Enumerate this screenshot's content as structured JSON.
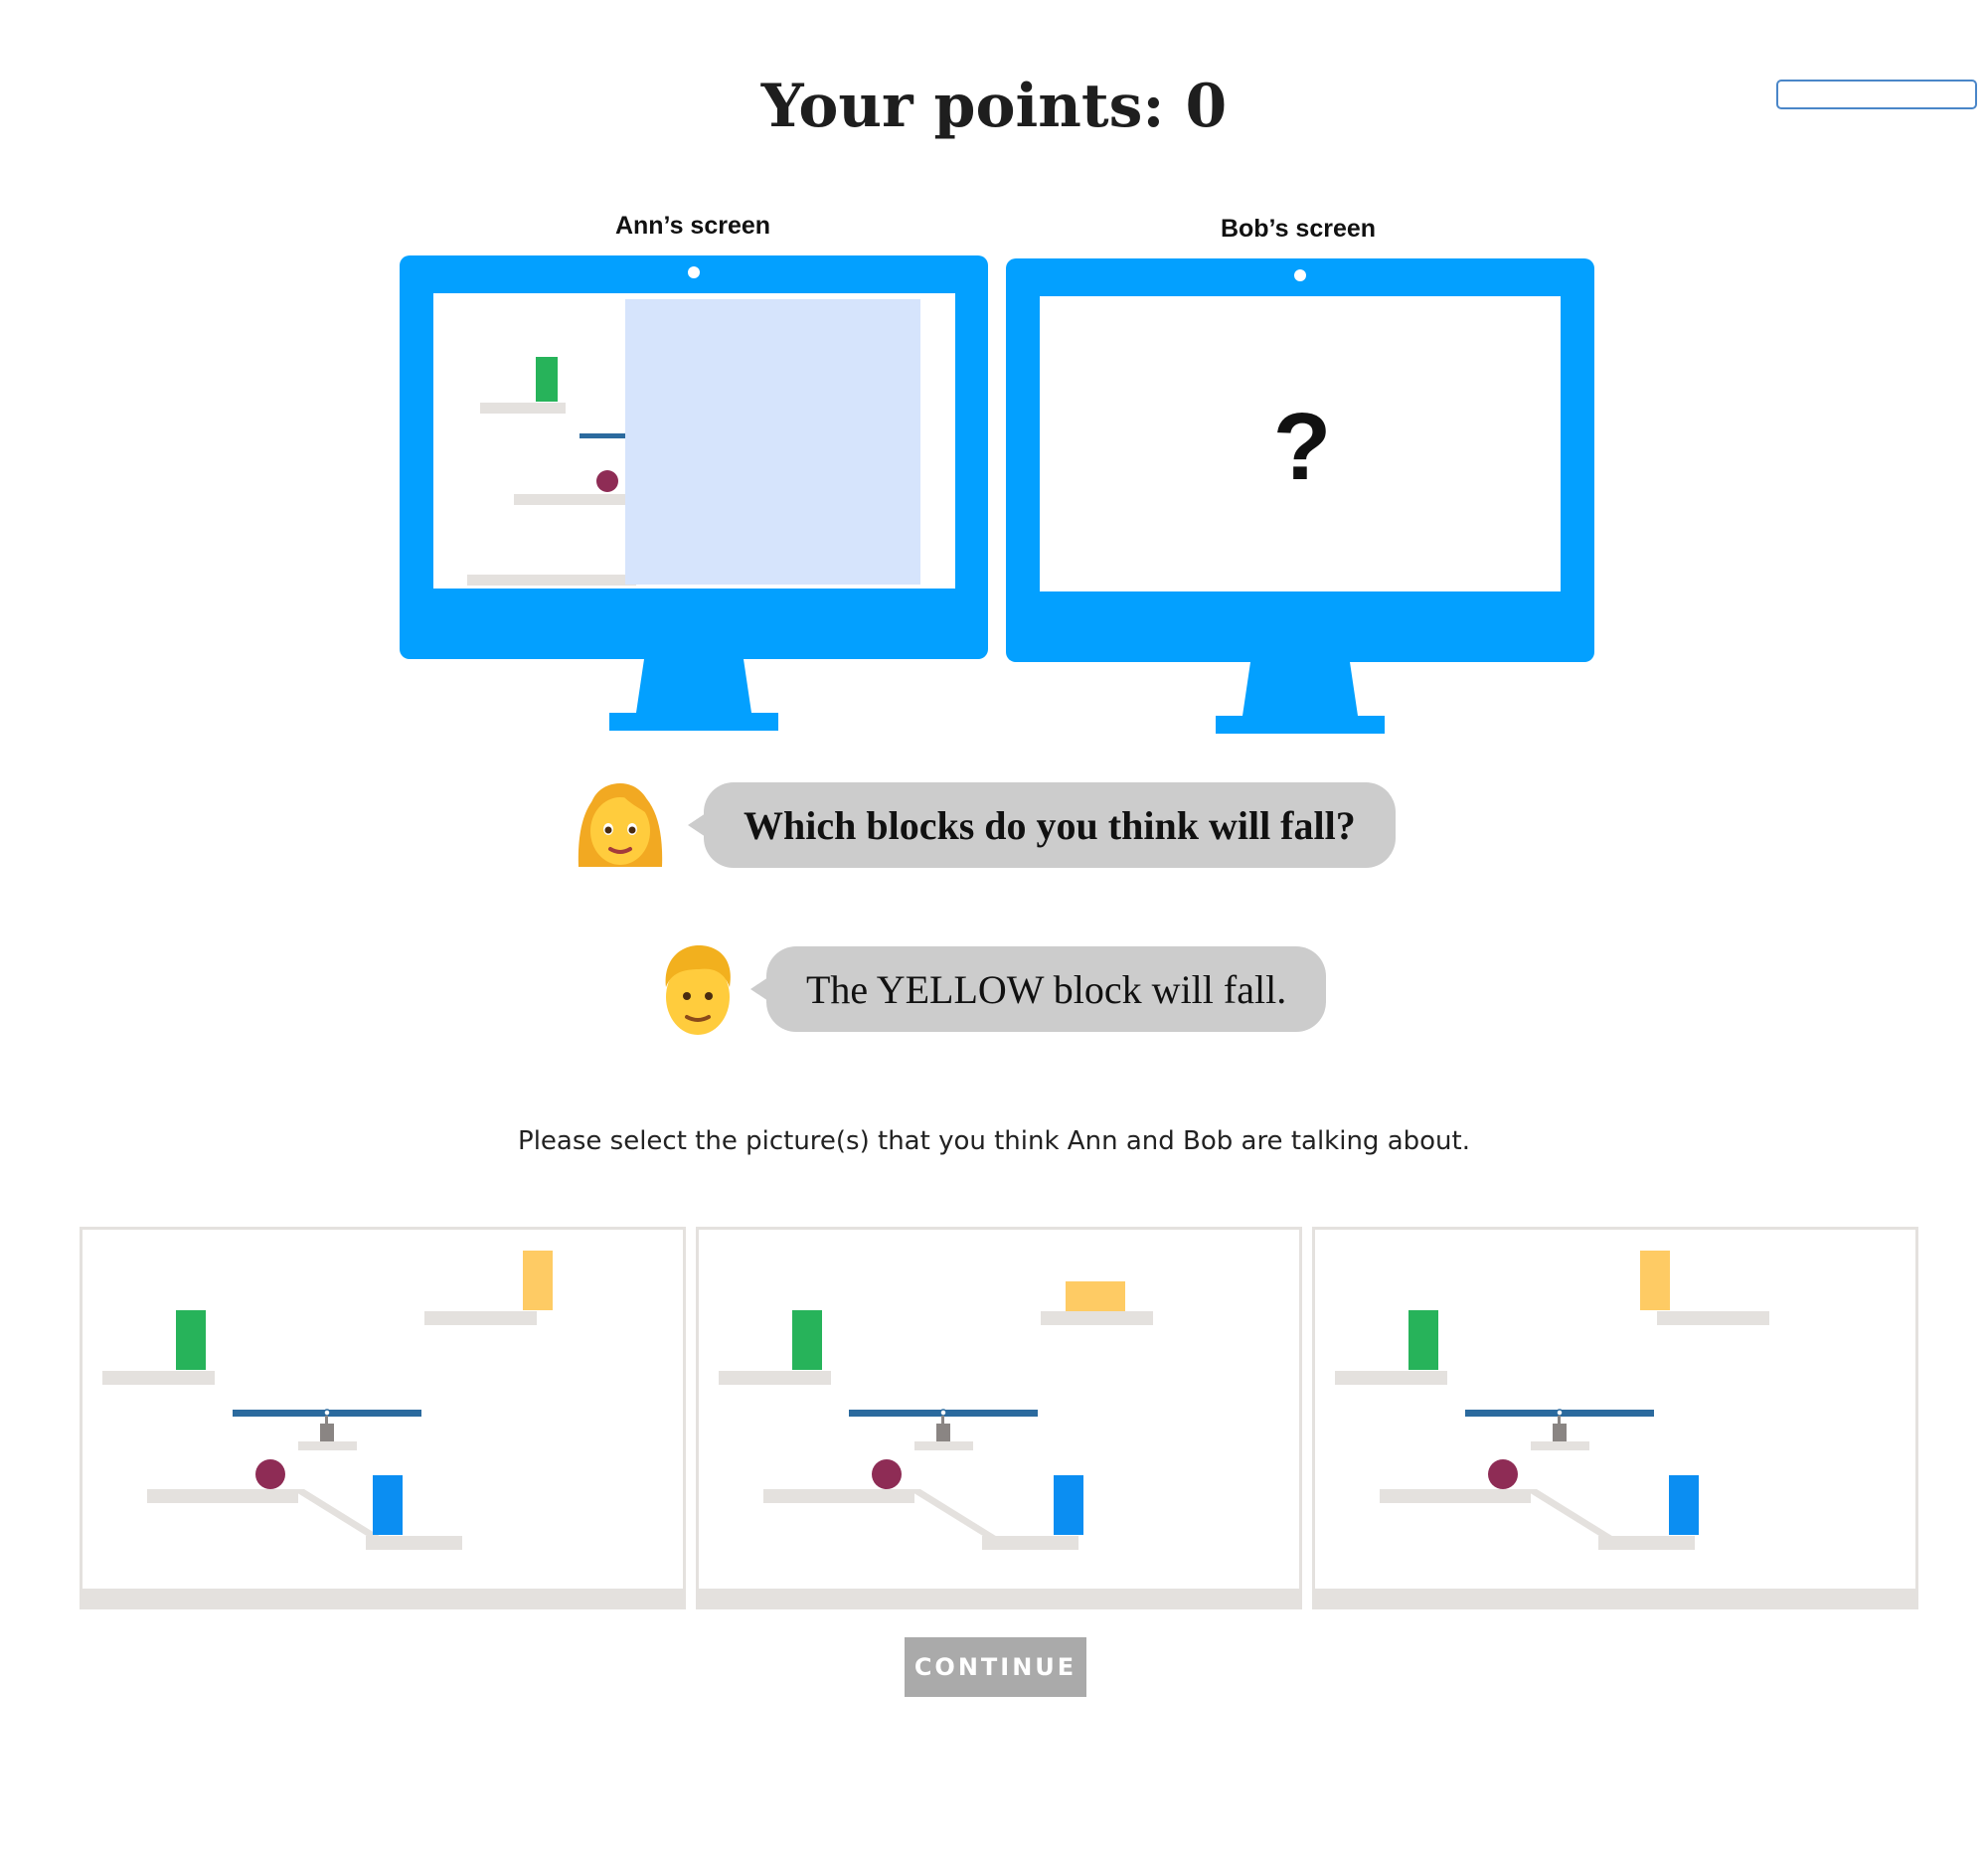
{
  "header": {
    "title": "Your points: 0"
  },
  "top_right_input": {
    "value": ""
  },
  "screens": {
    "ann_label": "Ann’s screen",
    "bob_label": "Bob’s screen",
    "bob_placeholder": "?"
  },
  "conversation": [
    {
      "speaker": "Ann",
      "avatar_icon": "woman-emoji-icon",
      "text": "Which blocks do you think will fall?"
    },
    {
      "speaker": "Bob",
      "avatar_icon": "man-emoji-icon",
      "text": "The YELLOW block will fall."
    }
  ],
  "instruction": "Please select the picture(s) that you think Ann and Bob are talking about.",
  "choices": [
    {
      "id": "choice-1",
      "yellow_block": "upright"
    },
    {
      "id": "choice-2",
      "yellow_block": "lying"
    },
    {
      "id": "choice-3",
      "yellow_block": "upright"
    }
  ],
  "continue_button": {
    "label": "CONTINUE"
  },
  "colors": {
    "monitor": "#03a0ff",
    "green_block": "#27b35a",
    "yellow_block": "#fecb64",
    "blue_block": "#0b8ef2",
    "ball": "#8e2c55",
    "seesaw": "#2b6a9e",
    "platform": "#e4e1de",
    "occluder": "#d6e4fc",
    "bubble": "#cccccc",
    "button": "#aaaaaa"
  }
}
